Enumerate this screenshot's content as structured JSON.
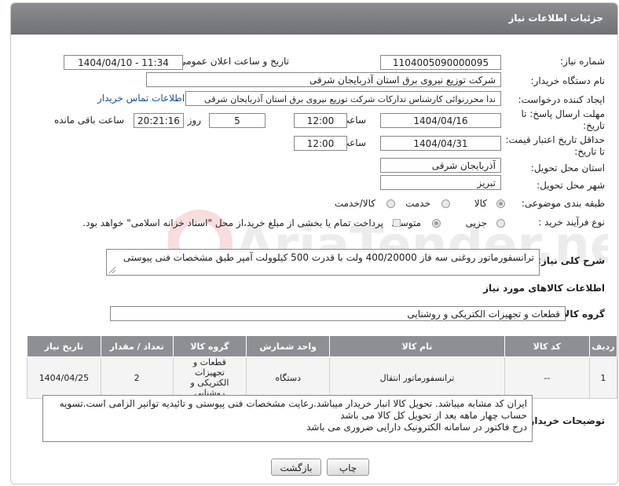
{
  "header": {
    "title": "جزئیات اطلاعات نیاز"
  },
  "watermark": {
    "text": "AriaTender.neT"
  },
  "fields": {
    "need_number_label": "شماره نیاز:",
    "need_number": "1104005090000095",
    "announce_label": "تاریخ و ساعت اعلان عمومی:",
    "announce_value": "1404/04/10 - 11:34",
    "buyer_org_label": "نام دستگاه خریدار:",
    "buyer_org": "شرکت توزیع نیروی برق استان آذربایجان شرقی",
    "creator_label": "ایجاد کننده درخواست:",
    "creator": "ندا محررنوائی کارشناس تدارکات شرکت توزیع نیروی برق استان آذربایجان شرقی",
    "contact_link": "اطلاعات تماس خریدار",
    "deadline_label_1": "مهلت ارسال پاسخ: تا",
    "deadline_label_2": "تاریخ:",
    "deadline_date": "1404/04/16",
    "time_label": "ساعت",
    "deadline_time": "12:00",
    "days_value": "5",
    "days_label": "روز و",
    "remaining_time": "20:21:16",
    "remaining_label": "ساعت باقی مانده",
    "min_validity_label_1": "حداقل تاریخ اعتبار قیمت:",
    "min_validity_label_2": "تا تاریخ:",
    "validity_date": "1404/04/31",
    "validity_time": "12:00",
    "province_label": "استان محل تحویل:",
    "province": "آذربایجان شرقی",
    "city_label": "شهر محل تحویل:",
    "city": "تبریز",
    "category_label": "طبقه بندی موضوعی:",
    "category_options": [
      "کالا",
      "خدمت",
      "کالا/خدمت"
    ],
    "category_selected": "کالا",
    "process_label": "نوع فرآیند خرید :",
    "process_options": [
      "جزیی",
      "متوسط"
    ],
    "process_selected": "متوسط",
    "payment_note": "پرداخت تمام یا بخشی از مبلغ خرید،از محل \"اسناد خزانه اسلامی\" خواهد بود."
  },
  "description": {
    "label": "شرح کلی نیاز:",
    "text": "ترانسفورماتور روغنی سه فاز 400/20000 ولت با قدرت 500 کیلوولت آمپر طبق مشخصات فنی پیوستی"
  },
  "goods_info": {
    "section_title": "اطلاعات کالاهای مورد نیاز",
    "group_label": "گروه کالا:",
    "group_value": "قطعات و تجهیزات الکتریکی و روشنایی"
  },
  "table": {
    "headers": [
      "ردیف",
      "کد کالا",
      "نام کالا",
      "واحد شمارش",
      "گروه کالا",
      "تعداد / مقدار",
      "تاریخ نیاز"
    ],
    "rows": [
      [
        "1",
        "--",
        "ترانسفورماتور انتقال",
        "دستگاه",
        "قطعات و تجهیزات الکتریکی و روشنایی",
        "2",
        "1404/04/25"
      ]
    ]
  },
  "buyer_notes": {
    "label": "توضیحات خریدار:",
    "line1": "ایران کد مشابه میباشد. تحویل کالا انبار خریدار میباشد.رعایت مشخصات فنی پیوستی و تائیدیه توانیر الزامی است.تسویه",
    "line2": "حساب چهار ماهه بعد از تحویل کل کالا می باشد",
    "line3": "درج فاکتور در سامانه الکترونیک دارایی ضروری می باشد"
  },
  "buttons": {
    "print": "چاپ",
    "back": "بازگشت"
  }
}
